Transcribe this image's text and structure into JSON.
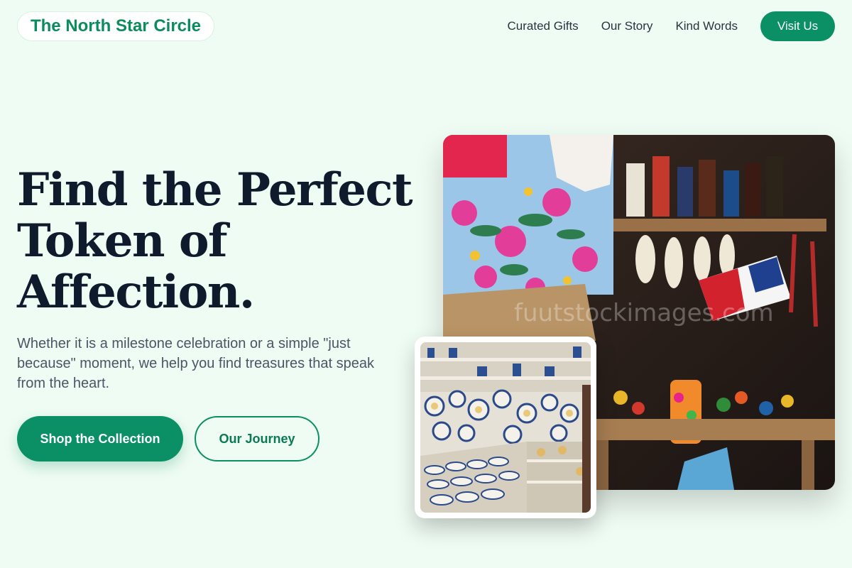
{
  "header": {
    "logo": "The North Star Circle",
    "nav": [
      "Curated Gifts",
      "Our Story",
      "Kind Words"
    ],
    "cta": "Visit Us"
  },
  "hero": {
    "title_lines": [
      "Find the Perfect",
      "Token of",
      "Affection."
    ],
    "subtitle": "Whether it is a milestone celebration or a simple \"just because\" moment, we help you find treasures that speak from the heart.",
    "primary_button": "Shop the Collection",
    "secondary_button": "Our Journey"
  },
  "images": {
    "main_watermark": "fuutstockimages.com"
  },
  "colors": {
    "background": "#effcf3",
    "accent": "#0a9064",
    "heading": "#0f1b2d"
  }
}
